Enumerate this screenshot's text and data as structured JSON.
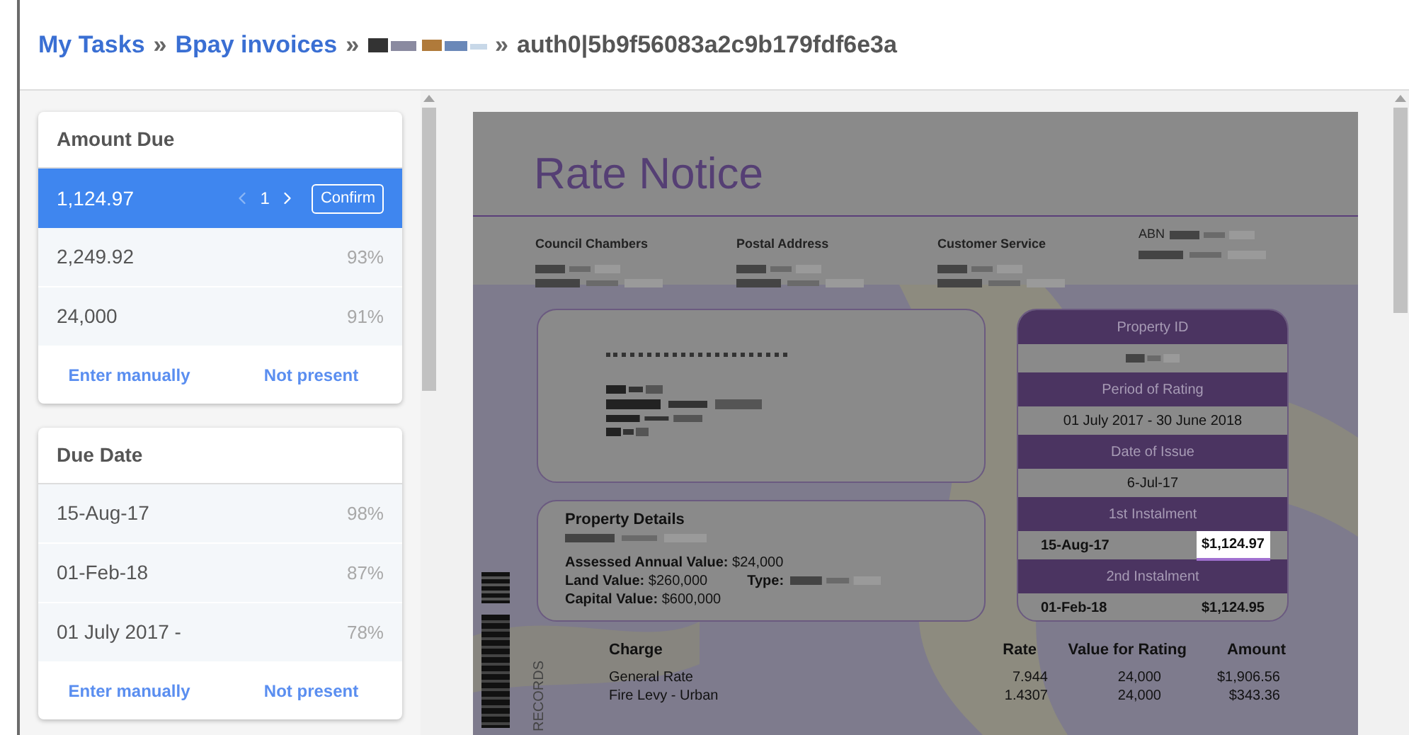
{
  "breadcrumb": {
    "separator": "»",
    "items": [
      {
        "kind": "link",
        "text": "My Tasks"
      },
      {
        "kind": "link",
        "text": "Bpay invoices"
      },
      {
        "kind": "redacted"
      },
      {
        "kind": "current",
        "text": "auth0|5b9f56083a2c9b179fdf6e3a"
      }
    ]
  },
  "fields": [
    {
      "title": "Amount Due",
      "candidates": [
        {
          "value": "1,124.97",
          "selected": true,
          "page": "1",
          "confirm": "Confirm"
        },
        {
          "value": "2,249.92",
          "confidence": "93%",
          "selected": false
        },
        {
          "value": "24,000",
          "confidence": "91%",
          "selected": false
        }
      ],
      "actions": [
        "Enter manually",
        "Not present"
      ]
    },
    {
      "title": "Due Date",
      "candidates": [
        {
          "value": "15-Aug-17",
          "confidence": "98%",
          "selected": false
        },
        {
          "value": "01-Feb-18",
          "confidence": "87%",
          "selected": false
        },
        {
          "value": "01 July 2017 -",
          "confidence": "78%",
          "selected": false
        }
      ],
      "actions": [
        "Enter manually",
        "Not present"
      ]
    }
  ],
  "document": {
    "title": "Rate Notice",
    "contacts": [
      {
        "label": "Council Chambers",
        "kind": "block"
      },
      {
        "label": "Postal Address",
        "kind": "block"
      },
      {
        "label": "Customer Service",
        "kind": "block"
      },
      {
        "label": "ABN",
        "kind": "inline"
      }
    ],
    "property_details": {
      "title": "Property Details",
      "lines": [
        [
          {
            "kind": "text",
            "label": "Assessed Annual Value:",
            "value": "$24,000"
          }
        ],
        [
          {
            "kind": "text",
            "label": "Land Value:",
            "value": "$260,000"
          },
          {
            "kind": "redacted",
            "label": "Type:"
          }
        ],
        [
          {
            "kind": "text",
            "label": "Capital Value:",
            "value": "$600,000"
          }
        ]
      ]
    },
    "info": [
      {
        "heading": "Property ID",
        "kind": "redacted"
      },
      {
        "heading": "Period of Rating",
        "kind": "value",
        "value": "01 July 2017 - 30 June 2018"
      },
      {
        "heading": "Date of Issue",
        "kind": "value",
        "value": "6-Jul-17"
      },
      {
        "heading": "1st Instalment",
        "kind": "instalment",
        "date": "15-Aug-17",
        "amount": "$1,124.97",
        "highlighted": true
      },
      {
        "heading": "2nd Instalment",
        "kind": "instalment",
        "date": "01-Feb-18",
        "amount": "$1,124.95",
        "highlighted": false
      }
    ],
    "side_label": "RECORDS",
    "charges": {
      "columns": [
        "Charge",
        "Rate",
        "Value for Rating",
        "Amount"
      ],
      "rows": [
        [
          "General Rate",
          "7.944",
          "24,000",
          "$1,906.56"
        ],
        [
          "Fire Levy - Urban",
          "1.4307",
          "24,000",
          "$343.36"
        ]
      ]
    }
  }
}
